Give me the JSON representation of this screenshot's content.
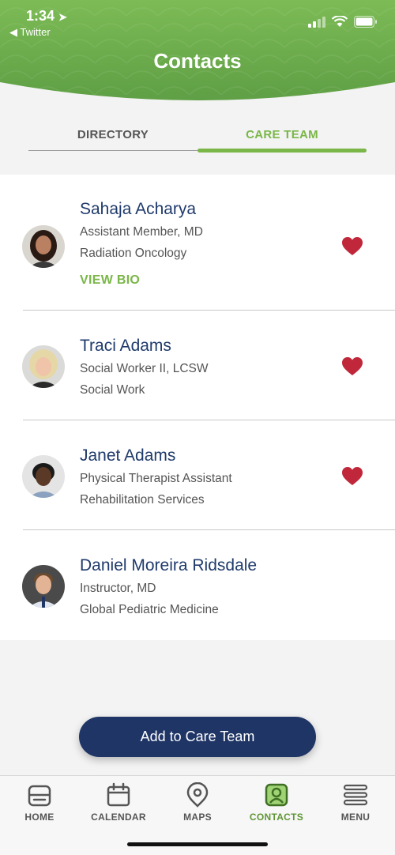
{
  "status_bar": {
    "time": "1:34",
    "back_label": "◀ Twitter"
  },
  "header": {
    "title": "Contacts"
  },
  "tabs": [
    {
      "label": "DIRECTORY",
      "active": false
    },
    {
      "label": "CARE TEAM",
      "active": true
    }
  ],
  "contacts": [
    {
      "name": "Sahaja Acharya",
      "title": "Assistant Member, MD",
      "department": "Radiation Oncology",
      "bio_link": "VIEW BIO",
      "favorite": true
    },
    {
      "name": "Traci Adams",
      "title": "Social Worker II, LCSW",
      "department": "Social Work",
      "favorite": true
    },
    {
      "name": "Janet Adams",
      "title": "Physical Therapist Assistant",
      "department": "Rehabilitation Services",
      "favorite": true
    },
    {
      "name": "Daniel Moreira Ridsdale",
      "title": "Instructor, MD",
      "department": "Global Pediatric Medicine",
      "favorite": false
    }
  ],
  "add_button": {
    "label": "Add to Care Team"
  },
  "tabbar": [
    {
      "label": "HOME",
      "icon": "home-icon",
      "active": false
    },
    {
      "label": "CALENDAR",
      "icon": "calendar-icon",
      "active": false
    },
    {
      "label": "MAPS",
      "icon": "map-pin-icon",
      "active": false
    },
    {
      "label": "CONTACTS",
      "icon": "contacts-icon",
      "active": true
    },
    {
      "label": "MENU",
      "icon": "menu-icon",
      "active": false
    }
  ],
  "colors": {
    "header_green": "#7ab648",
    "navy": "#1f3566",
    "heart_red": "#c1273a"
  }
}
